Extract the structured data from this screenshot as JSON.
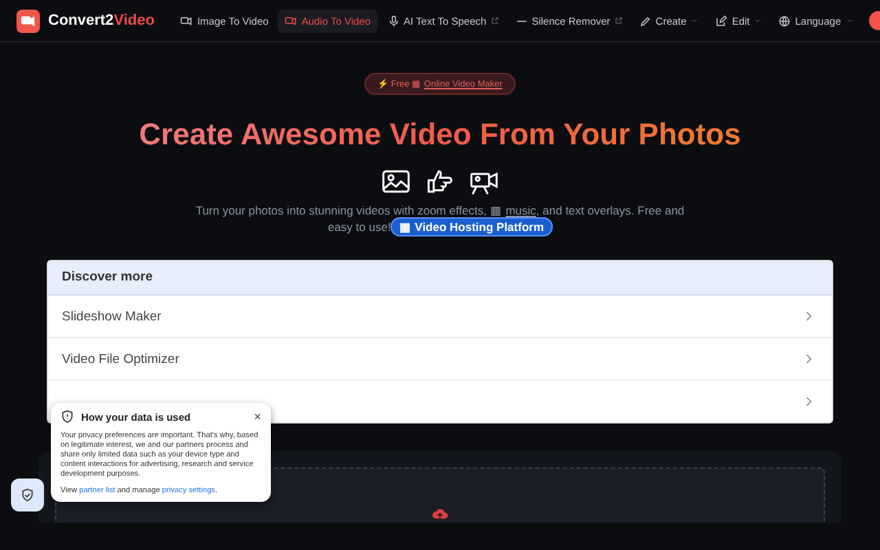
{
  "header": {
    "logo": {
      "text": "Convert2",
      "accent": "Video"
    },
    "nav": [
      {
        "label": "Image To Video",
        "kind": "video",
        "selected": false,
        "external": false,
        "dropdown": false
      },
      {
        "label": "Audio To Video",
        "kind": "video",
        "selected": true,
        "external": false,
        "dropdown": false
      },
      {
        "label": "AI Text To Speech",
        "kind": "mic",
        "selected": false,
        "external": true,
        "dropdown": false
      },
      {
        "label": "Silence Remover",
        "kind": "dash",
        "selected": false,
        "external": true,
        "dropdown": false
      },
      {
        "label": "Create",
        "kind": "pen",
        "selected": false,
        "external": false,
        "dropdown": true
      },
      {
        "label": "Edit",
        "kind": "edit",
        "selected": false,
        "external": false,
        "dropdown": true
      },
      {
        "label": "Language",
        "kind": "globe",
        "selected": false,
        "external": false,
        "dropdown": true
      }
    ]
  },
  "hero": {
    "badge": {
      "prefix": "⚡ Free ▦ ",
      "link": "Online Video Maker"
    },
    "title": "Create Awesome Video From Your Photos",
    "subtitle": {
      "before": "Turn your photos into stunning videos with zoom effects, ▦ ",
      "link": "music",
      "after": ", and text overlays. Free and easy to use!",
      "button": "▦ Video Hosting Platform"
    }
  },
  "discover": {
    "title": "Discover more",
    "rows": [
      {
        "label": "Slideshow Maker"
      },
      {
        "label": "Video File Optimizer"
      },
      {}
    ]
  },
  "privacy": {
    "title": "How your data is used",
    "close": "×",
    "body": "Your privacy preferences are important. That's why, based on legitimate interest, we and our partners process and share only limited data such as your device type and content interactions for advertising, research and service development purposes.",
    "footer": {
      "before": "View ",
      "link1": "partner list",
      "middle": " and manage ",
      "link2": "privacy settings",
      "after": "."
    }
  }
}
